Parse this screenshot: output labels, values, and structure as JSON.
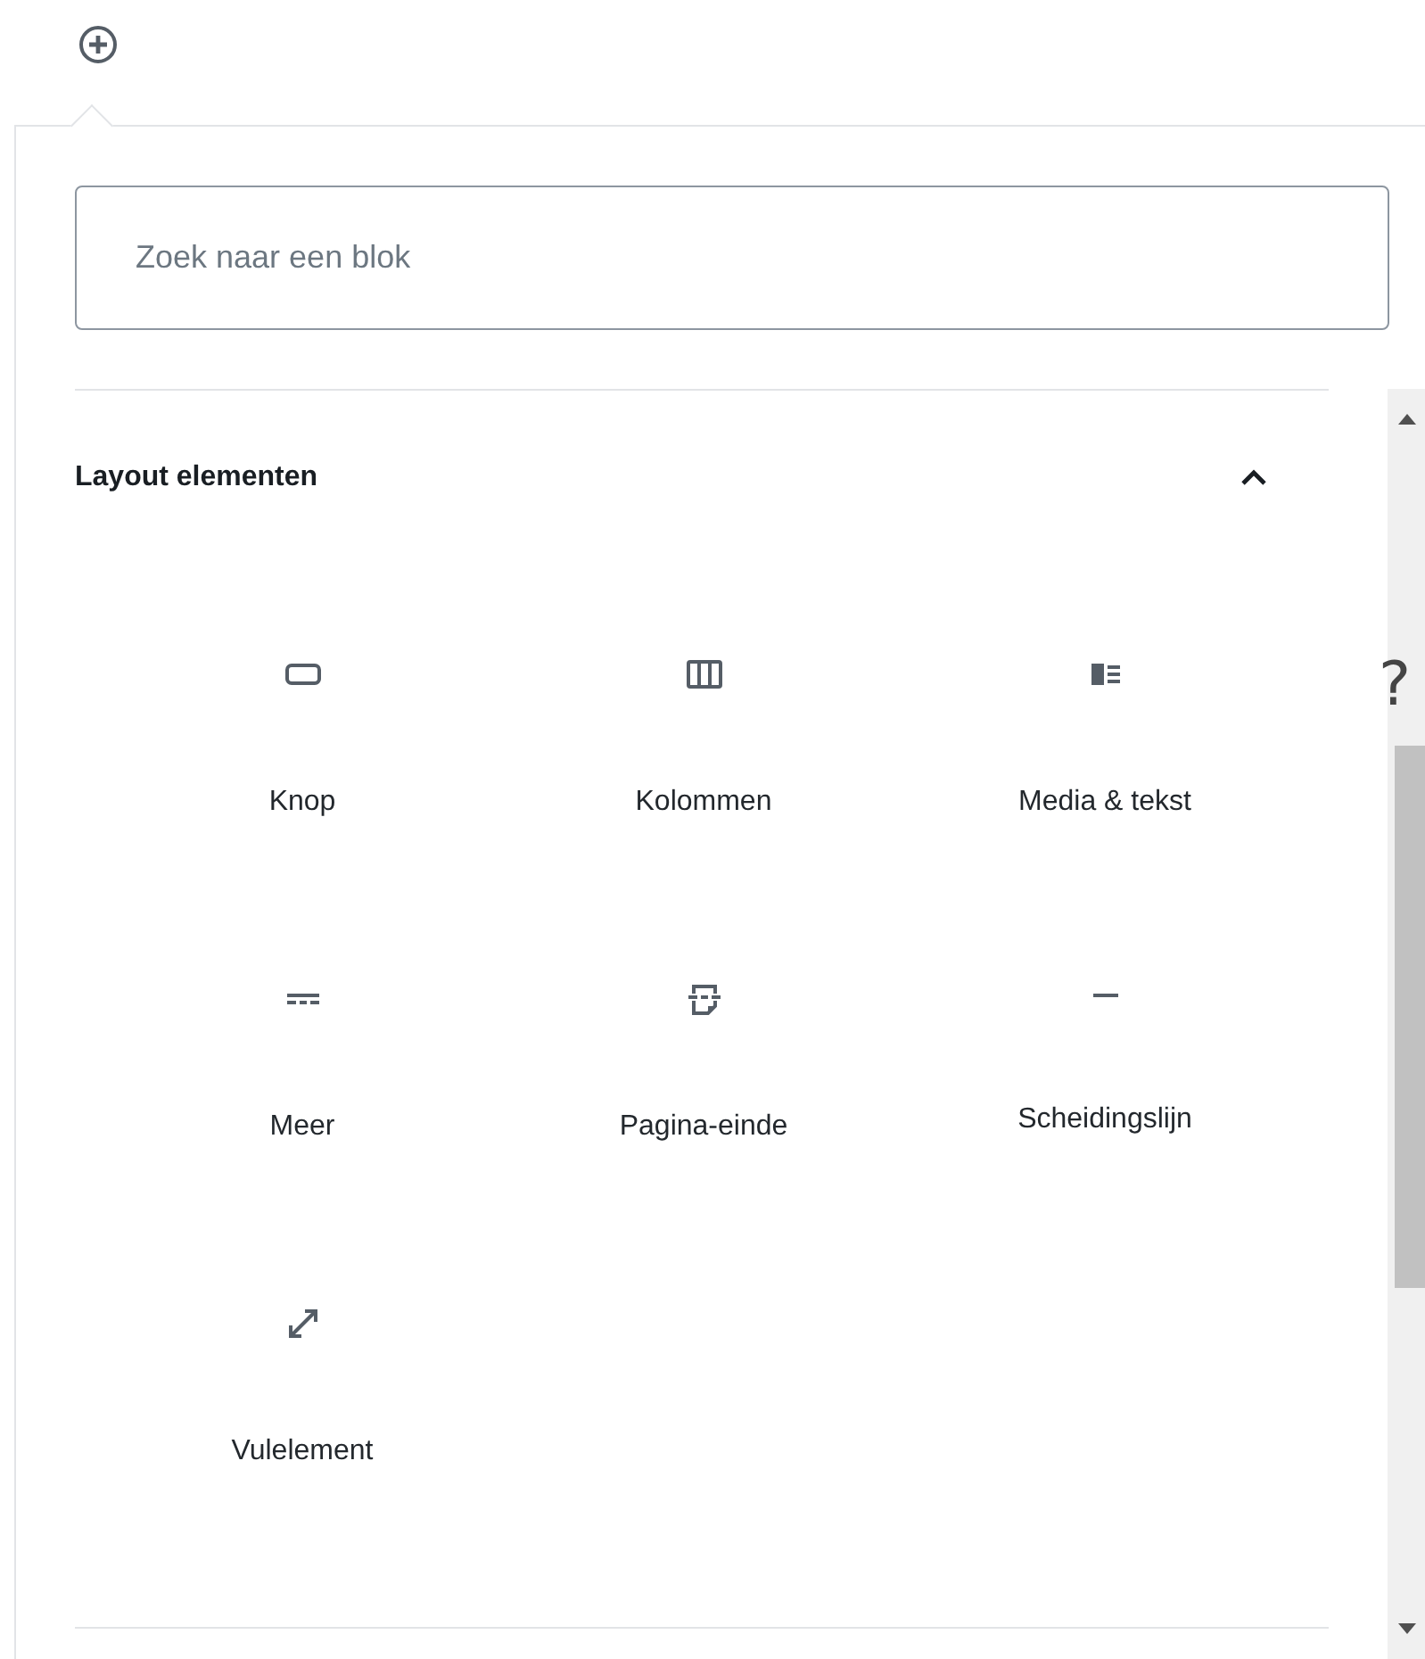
{
  "search": {
    "placeholder": "Zoek naar een blok"
  },
  "sections": [
    {
      "title": "Layout elementen",
      "expanded": true,
      "blocks": [
        {
          "label": "Knop",
          "kind": "button"
        },
        {
          "label": "Kolommen",
          "kind": "columns"
        },
        {
          "label": "Media & tekst",
          "kind": "media-text"
        },
        {
          "label": "Meer",
          "kind": "more"
        },
        {
          "label": "Pagina-einde",
          "kind": "page-break"
        },
        {
          "label": "Scheidingslijn",
          "kind": "separator"
        },
        {
          "label": "Vulelement",
          "kind": "spacer"
        }
      ]
    }
  ],
  "overlay_text": "?"
}
